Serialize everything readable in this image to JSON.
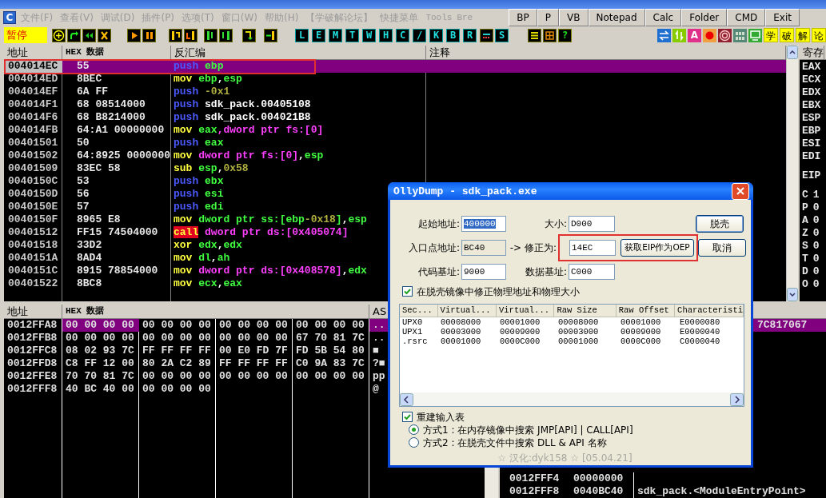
{
  "menu": {
    "app_icon": "C",
    "items": [
      "文件(F)",
      "查看(V)",
      "调试(D)",
      "插件(P)",
      "选项(T)",
      "窗口(W)",
      "帮助(H)",
      "【学破解论坛】",
      "快捷菜单",
      "Tools",
      "Bre"
    ],
    "quick_buttons": [
      "BP",
      "P",
      "VB",
      "Notepad",
      "Calc",
      "Folder",
      "CMD",
      "Exit"
    ]
  },
  "toolbar": {
    "status": "暂停",
    "letter_buttons": [
      "L",
      "E",
      "M",
      "T",
      "W",
      "H",
      "C",
      "/",
      "K",
      "B",
      "R"
    ],
    "last_letter": "S",
    "help_button": "?",
    "a_button": "A",
    "forum_buttons": [
      "学",
      "破",
      "解",
      "论"
    ]
  },
  "cpu": {
    "columns": [
      "地址",
      "HEX 数据",
      "反汇编",
      "注释"
    ],
    "rows": [
      {
        "address": "004014EC",
        "hex": "55",
        "mnemonic": {
          "text": "push",
          "kind": "stack"
        },
        "operands": [
          {
            "text": "ebp",
            "kind": "reg"
          }
        ],
        "selected": true,
        "highlighted": true
      },
      {
        "address": "004014ED",
        "hex": "8BEC",
        "mnemonic": {
          "text": "mov",
          "kind": "plain"
        },
        "operands": [
          {
            "text": "ebp",
            "kind": "reg"
          },
          {
            "text": ",",
            "kind": "sep"
          },
          {
            "text": "esp",
            "kind": "reg"
          }
        ],
        "selected": false,
        "highlighted": false
      },
      {
        "address": "004014EF",
        "hex": "6A FF",
        "mnemonic": {
          "text": "push",
          "kind": "stack"
        },
        "operands": [
          {
            "text": "-0x1",
            "kind": "imm"
          }
        ],
        "selected": false,
        "highlighted": false
      },
      {
        "address": "004014F1",
        "hex": "68 08514000",
        "mnemonic": {
          "text": "push",
          "kind": "stack"
        },
        "operands": [
          {
            "text": "sdk_pack.00405108",
            "kind": "sym"
          }
        ],
        "selected": false,
        "highlighted": false
      },
      {
        "address": "004014F6",
        "hex": "68 B8214000",
        "mnemonic": {
          "text": "push",
          "kind": "stack"
        },
        "operands": [
          {
            "text": "sdk_pack.004021B8",
            "kind": "sym"
          }
        ],
        "selected": false,
        "highlighted": false
      },
      {
        "address": "004014FB",
        "hex": "64:A1 00000000",
        "mnemonic": {
          "text": "mov",
          "kind": "plain"
        },
        "operands": [
          {
            "text": "eax",
            "kind": "reg"
          },
          {
            "text": ",dword ptr fs:[0]",
            "kind": "mem"
          }
        ],
        "selected": false,
        "highlighted": false
      },
      {
        "address": "00401501",
        "hex": "50",
        "mnemonic": {
          "text": "push",
          "kind": "stack"
        },
        "operands": [
          {
            "text": "eax",
            "kind": "reg"
          }
        ],
        "selected": false,
        "highlighted": false
      },
      {
        "address": "00401502",
        "hex": "64:8925 0000000",
        "mnemonic": {
          "text": "mov",
          "kind": "plain"
        },
        "operands": [
          {
            "text": "dword ptr fs:[0]",
            "kind": "mem"
          },
          {
            "text": ",",
            "kind": "sep"
          },
          {
            "text": "esp",
            "kind": "reg"
          }
        ],
        "selected": false,
        "highlighted": false
      },
      {
        "address": "00401509",
        "hex": "83EC 58",
        "mnemonic": {
          "text": "sub",
          "kind": "plain"
        },
        "operands": [
          {
            "text": "esp",
            "kind": "reg"
          },
          {
            "text": ",",
            "kind": "sep"
          },
          {
            "text": "0x58",
            "kind": "imm"
          }
        ],
        "selected": false,
        "highlighted": false
      },
      {
        "address": "0040150C",
        "hex": "53",
        "mnemonic": {
          "text": "push",
          "kind": "stack"
        },
        "operands": [
          {
            "text": "ebx",
            "kind": "reg"
          }
        ],
        "selected": false,
        "highlighted": false
      },
      {
        "address": "0040150D",
        "hex": "56",
        "mnemonic": {
          "text": "push",
          "kind": "stack"
        },
        "operands": [
          {
            "text": "esi",
            "kind": "reg"
          }
        ],
        "selected": false,
        "highlighted": false
      },
      {
        "address": "0040150E",
        "hex": "57",
        "mnemonic": {
          "text": "push",
          "kind": "stack"
        },
        "operands": [
          {
            "text": "edi",
            "kind": "reg"
          }
        ],
        "selected": false,
        "highlighted": false
      },
      {
        "address": "0040150F",
        "hex": "8965 E8",
        "mnemonic": {
          "text": "mov",
          "kind": "plain"
        },
        "operands": [
          {
            "text": "dword ptr ss:[ebp",
            "kind": "local"
          },
          {
            "text": "-0x18",
            "kind": "imm"
          },
          {
            "text": "]",
            "kind": "local"
          },
          {
            "text": ",",
            "kind": "sep"
          },
          {
            "text": "esp",
            "kind": "reg"
          }
        ],
        "selected": false,
        "highlighted": false
      },
      {
        "address": "00401512",
        "hex": "FF15 74504000",
        "mnemonic": {
          "text": "call",
          "kind": "call"
        },
        "operands": [
          {
            "text": "dword ptr ds:[0x405074]",
            "kind": "mem"
          }
        ],
        "selected": false,
        "highlighted": false
      },
      {
        "address": "00401518",
        "hex": "33D2",
        "mnemonic": {
          "text": "xor",
          "kind": "plain"
        },
        "operands": [
          {
            "text": "edx",
            "kind": "reg"
          },
          {
            "text": ",",
            "kind": "sep"
          },
          {
            "text": "edx",
            "kind": "reg"
          }
        ],
        "selected": false,
        "highlighted": false
      },
      {
        "address": "0040151A",
        "hex": "8AD4",
        "mnemonic": {
          "text": "mov",
          "kind": "plain"
        },
        "operands": [
          {
            "text": "dl",
            "kind": "reg"
          },
          {
            "text": ",",
            "kind": "sep"
          },
          {
            "text": "ah",
            "kind": "reg"
          }
        ],
        "selected": false,
        "highlighted": false
      },
      {
        "address": "0040151C",
        "hex": "8915 78854000",
        "mnemonic": {
          "text": "mov",
          "kind": "plain"
        },
        "operands": [
          {
            "text": "dword ptr ds:[0x408578]",
            "kind": "mem"
          },
          {
            "text": ",",
            "kind": "sep"
          },
          {
            "text": "edx",
            "kind": "reg"
          }
        ],
        "selected": false,
        "highlighted": false
      },
      {
        "address": "00401522",
        "hex": "8BC8",
        "mnemonic": {
          "text": "mov",
          "kind": "plain"
        },
        "operands": [
          {
            "text": "ecx",
            "kind": "reg"
          },
          {
            "text": ",",
            "kind": "sep"
          },
          {
            "text": "eax",
            "kind": "reg"
          }
        ],
        "selected": false,
        "highlighted": false
      }
    ]
  },
  "registers": {
    "title": "寄存",
    "names": [
      "EAX",
      "ECX",
      "EDX",
      "EBX",
      "ESP",
      "EBP",
      "ESI",
      "EDI"
    ],
    "eip": "EIP",
    "flags": [
      {
        "name": "C",
        "value": "1"
      },
      {
        "name": "P",
        "value": "0"
      },
      {
        "name": "A",
        "value": "0"
      },
      {
        "name": "Z",
        "value": "0"
      },
      {
        "name": "S",
        "value": "0"
      },
      {
        "name": "T",
        "value": "0"
      },
      {
        "name": "D",
        "value": "0"
      },
      {
        "name": "O",
        "value": "0"
      }
    ]
  },
  "dump": {
    "columns": [
      "地址",
      "HEX 数据",
      "AS"
    ],
    "rows": [
      {
        "address": "0012FFA8",
        "groups": [
          "00 00 00 00",
          "00 00 00 00",
          "00 00 00 00",
          "00 00 00 00"
        ],
        "ascii": "..",
        "selected": true
      },
      {
        "address": "0012FFB8",
        "groups": [
          "00 00 00 00",
          "00 00 00 00",
          "00 00 00 00",
          "67 70 81 7C"
        ],
        "ascii": "..",
        "selected": false
      },
      {
        "address": "0012FFC8",
        "groups": [
          "08 02 93 7C",
          "FF FF FF FF",
          "00 E0 FD 7F",
          "FD 5B 54 80"
        ],
        "ascii": "■",
        "selected": false
      },
      {
        "address": "0012FFD8",
        "groups": [
          "C8 FF 12 00",
          "80 2A C2 89",
          "FF FF FF FF",
          "C0 9A 83 7C"
        ],
        "ascii": "?■",
        "selected": false
      },
      {
        "address": "0012FFE8",
        "groups": [
          "70 70 81 7C",
          "00 00 00 00",
          "00 00 00 00",
          "00 00 00 00"
        ],
        "ascii": "pp",
        "selected": false
      },
      {
        "address": "0012FFF8",
        "groups": [
          "40 BC 40 00",
          "00 00 00 00"
        ],
        "ascii": "@",
        "selected": false
      }
    ]
  },
  "stack": {
    "rows": [
      {
        "comment": "7C817067",
        "selected": true
      },
      {
        "address": "0012FFF4",
        "value": "00000000",
        "selected": false
      },
      {
        "address": "0012FFF8",
        "value": "0040BC40",
        "comment": "sdk_pack.<ModuleEntryPoint>",
        "selected": false
      }
    ]
  },
  "dialog": {
    "title": "OllyDump - sdk_pack.exe",
    "start_address": {
      "label": "起始地址:",
      "value": "400000",
      "text_selected": true
    },
    "size": {
      "label": "大小:",
      "value": "D000"
    },
    "entry_point": {
      "label": "入口点地址:",
      "value": "BC40",
      "disabled": true
    },
    "fix_to": {
      "label": "-> 修正为:",
      "value": "14EC",
      "highlighted": true
    },
    "get_eip_button": "获取EIP作为OEP",
    "code_base": {
      "label": "代码基址:",
      "value": "9000"
    },
    "data_base": {
      "label": "数据基址:",
      "value": "C000"
    },
    "buttons": [
      "脱壳",
      "取消"
    ],
    "fix_raw": {
      "label": "在脱壳镜像中修正物理地址和物理大小",
      "checked": true
    },
    "sections": {
      "columns": [
        "Sec...",
        "Virtual...",
        "Virtual...",
        "Raw Size",
        "Raw Offset",
        "Characteristi"
      ],
      "rows": [
        [
          "UPX0",
          "00008000",
          "00001000",
          "00008000",
          "00001000",
          "E0000080"
        ],
        [
          "UPX1",
          "00003000",
          "00009000",
          "00003000",
          "00009000",
          "E0000040"
        ],
        [
          ".rsrc",
          "00001000",
          "0000C000",
          "00001000",
          "0000C000",
          "C0000040"
        ]
      ]
    },
    "rebuild_import": {
      "label": "重建输入表",
      "checked": true
    },
    "methods": [
      {
        "label": "方式1 : 在内存镜像中搜索 JMP[API] | CALL[API]",
        "selected": true
      },
      {
        "label": "方式2 : 在脱壳文件中搜索 DLL & API 名称",
        "selected": false
      }
    ],
    "credit": "☆ 汉化:dyk158 ☆ [05.04.21]"
  }
}
